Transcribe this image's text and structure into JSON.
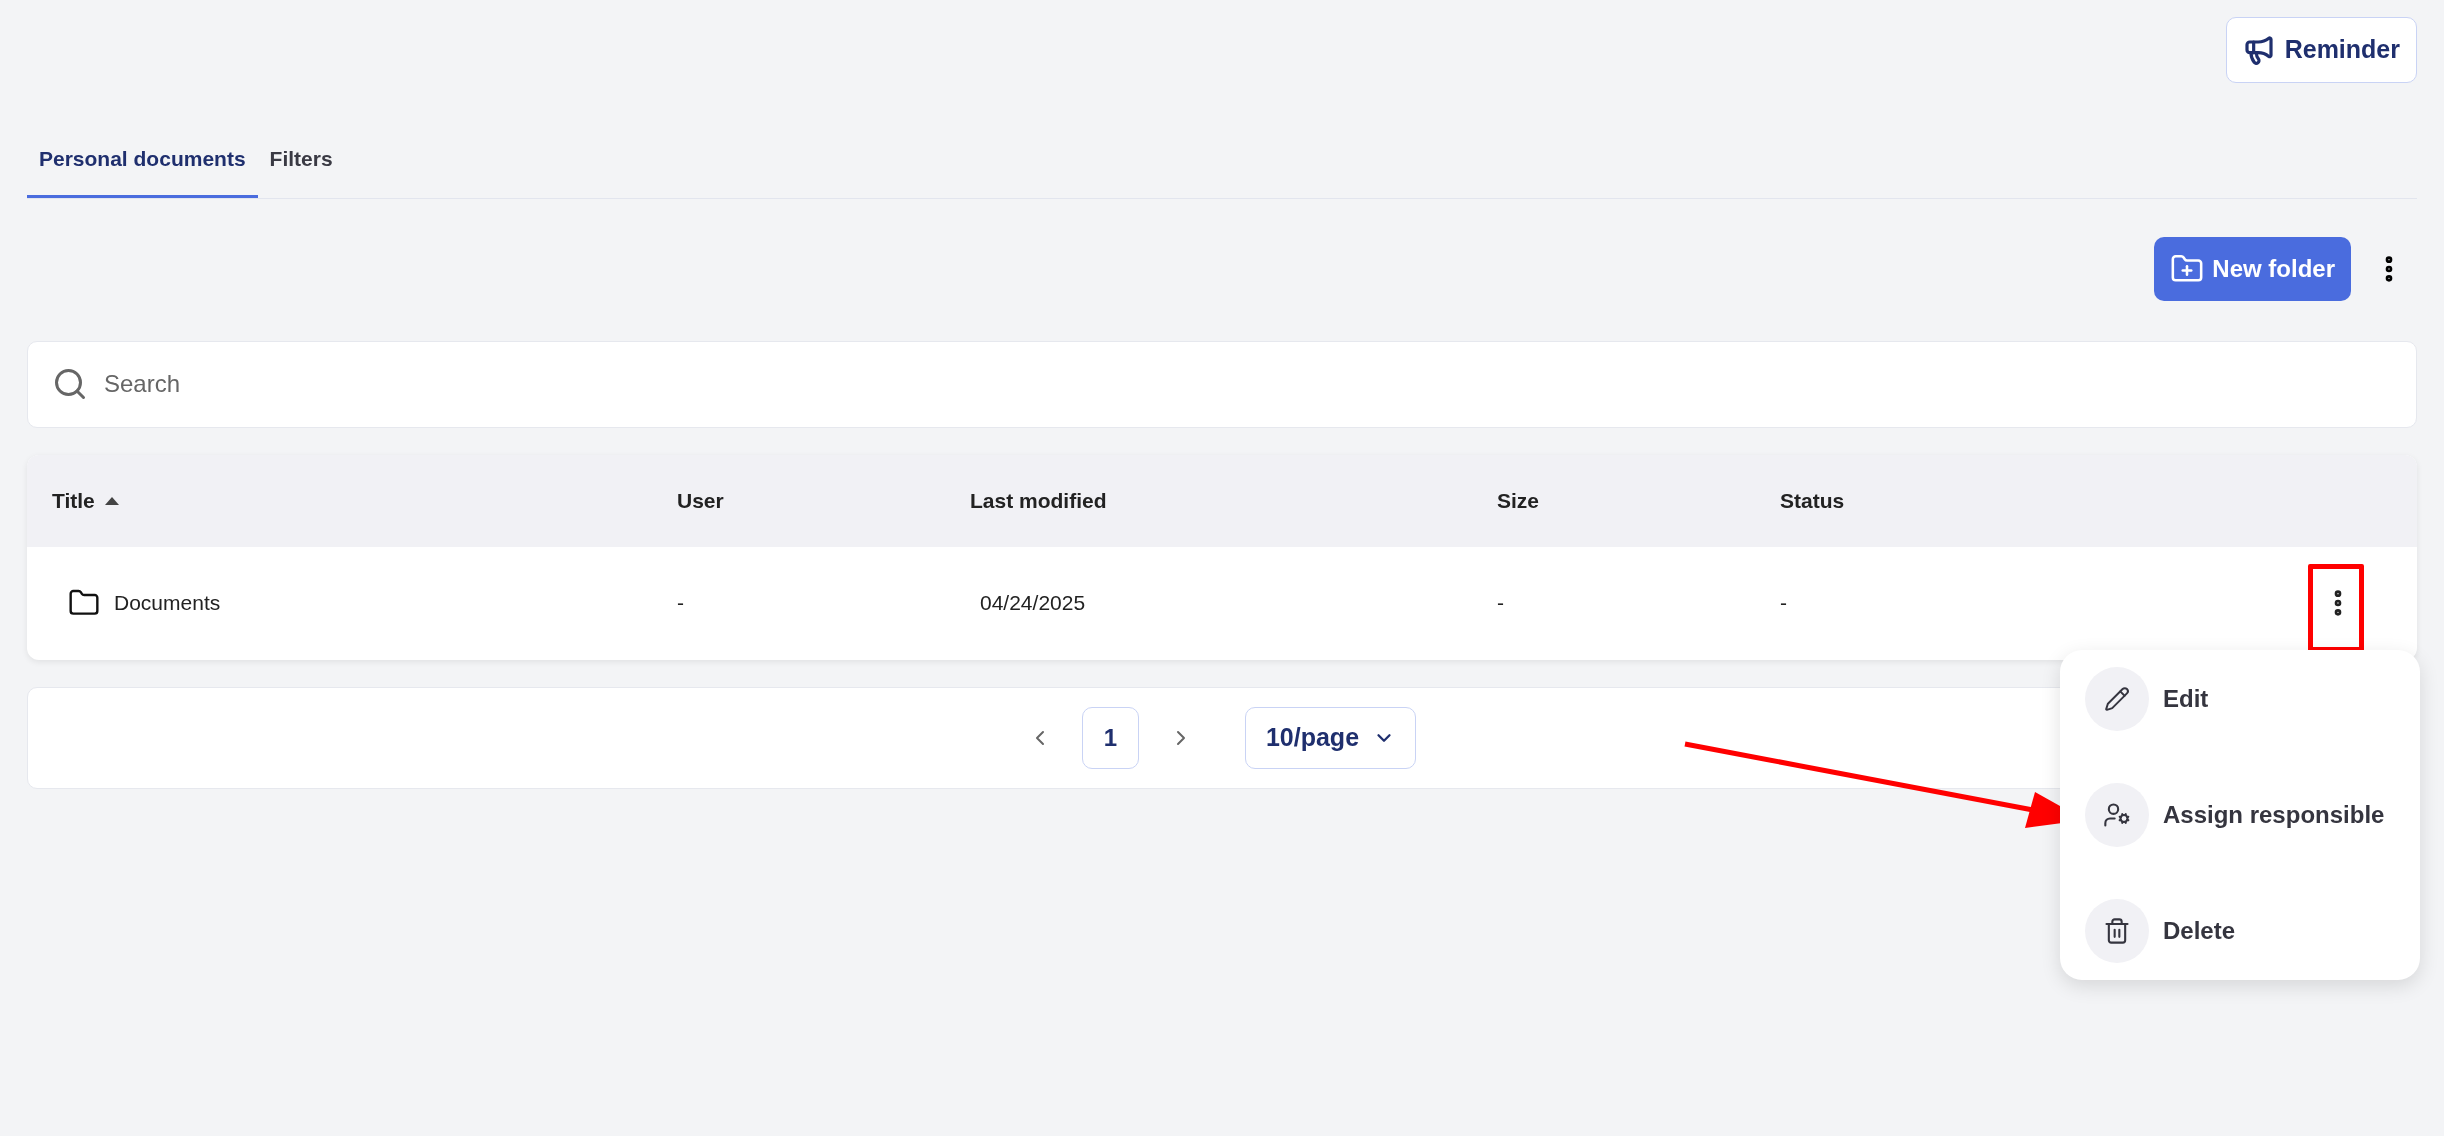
{
  "header": {
    "reminder_button": "Reminder"
  },
  "tabs": [
    {
      "label": "Personal documents",
      "selected": true
    },
    {
      "label": "Filters",
      "selected": false
    }
  ],
  "toolbar": {
    "new_folder_button": "New folder"
  },
  "search": {
    "placeholder": "Search"
  },
  "table": {
    "columns": [
      {
        "label": "Title",
        "sorted": true
      },
      {
        "label": "User",
        "sorted": false
      },
      {
        "label": "Last modified",
        "sorted": false
      },
      {
        "label": "Size",
        "sorted": false
      },
      {
        "label": "Status",
        "sorted": false
      }
    ],
    "rows": [
      {
        "kind": "folder",
        "cells": [
          "Documents",
          "-",
          "04/24/2025",
          "-",
          "-"
        ]
      }
    ]
  },
  "pagination": {
    "pages": [
      {
        "label": "1",
        "selected": true
      }
    ],
    "page_size": "10/page"
  },
  "row_menu": {
    "items": [
      {
        "kind": "edit",
        "label": "Edit"
      },
      {
        "kind": "assign",
        "label": "Assign responsible"
      },
      {
        "kind": "delete",
        "label": "Delete"
      }
    ]
  }
}
